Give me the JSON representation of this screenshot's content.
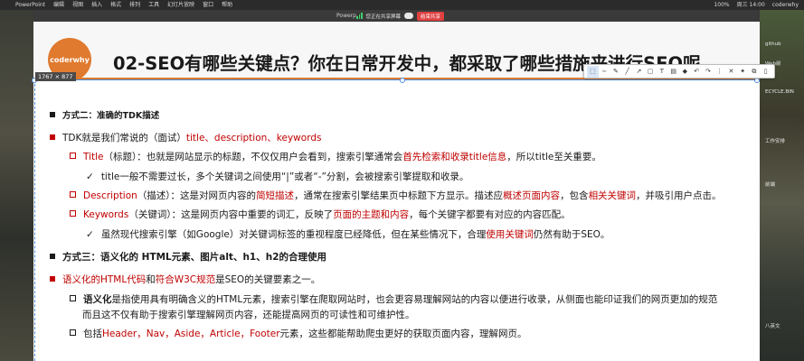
{
  "menubar": {
    "left": [
      "",
      "PowerPoint",
      "编辑",
      "视图",
      "插入",
      "格式",
      "排列",
      "工具",
      "幻灯片放映",
      "窗口",
      "帮助"
    ],
    "right": [
      "100%",
      "周三 14:00",
      "coderwhy"
    ]
  },
  "window": {
    "title": "Powerp",
    "share_status": "您正在共享屏幕",
    "stop_share": "结束共享"
  },
  "desktop": {
    "labels": [
      "github",
      "Web前",
      "ECYCLE.BIN",
      "工作安排",
      "前端",
      "八英文"
    ]
  },
  "slide": {
    "logo": "coderwhy",
    "title": "02-SEO有哪些关键点？你在日常开发中，都采取了哪些措施来进行SEO呢",
    "size_label": "1767 × 877",
    "lines": {
      "l1": "方式二：准确的TDK描述",
      "l2a": "TDK就是我们常说的（面试）",
      "l2b": "title、description、keywords",
      "l3a": "Title",
      "l3b": "（标题）：也就是网站显示的标题，不仅仅用户会看到，搜索引擎通常会",
      "l3c": "首先检索和收录title信息",
      "l3d": "，所以title至关重要。",
      "l4": "title一般不需要过长，多个关键词之间使用“|”或者“-”分割，会被搜索引擎提取和收录。",
      "l5a": "Description",
      "l5b": "（描述）：这是对网页内容的",
      "l5c": "简短描述",
      "l5d": "，通常在搜索引擎结果页中标题下方显示。描述应",
      "l5e": "概述页面内容",
      "l5f": "，包含",
      "l5g": "相关关键词",
      "l5h": "，并吸引用户点击。",
      "l6a": "Keywords",
      "l6b": "（关键词）：这是网页内容中重要的词汇，反映了",
      "l6c": "页面的主题和内容",
      "l6d": "，每个关键字都要有对应的内容匹配。",
      "l7a": "虽然现代搜索引擎（如Google）对关键词标签的重视程度已经降低，但在某些情况下，合理",
      "l7b": "使用关键词",
      "l7c": "仍然有助于SEO。",
      "l8": "方式三：语义化的 HTML元素、图片alt、h1、h2的合理使用",
      "l9a": "语义化的HTML代码",
      "l9b": "和",
      "l9c": "符合W3C规范",
      "l9d": "是SEO的关键要素之一。",
      "l10a": "语义化",
      "l10b": "是指使用具有明确含义的HTML元素，搜索引擎在爬取网站时，也会更容易理解网站的内容以便进行收录，从侧面也能印证我们的网页更加的规范",
      "l11": "而且这不仅有助于搜索引擎理解网页内容，还能提高网页的可读性和可维护性。",
      "l12a": "包括",
      "l12b": "Header，Nav，Aside，Article，Footer",
      "l12c": "元素，这些都能帮助爬虫更好的获取页面内容，理解网页。"
    }
  },
  "toolbar_icons": [
    "select-icon",
    "curve-icon",
    "pen-icon",
    "line-icon",
    "arrow-icon",
    "rectangle-icon",
    "text-icon",
    "highlighter-icon",
    "eraser-icon",
    "undo-icon",
    "redo-icon",
    "clear-icon",
    "close-icon",
    "pin-icon",
    "copy-icon",
    "save-icon"
  ],
  "colors": {
    "accent": "#e07a2e",
    "highlight_red": "#c00000",
    "share_green": "#3fd06a",
    "stop_red": "#e04040"
  }
}
